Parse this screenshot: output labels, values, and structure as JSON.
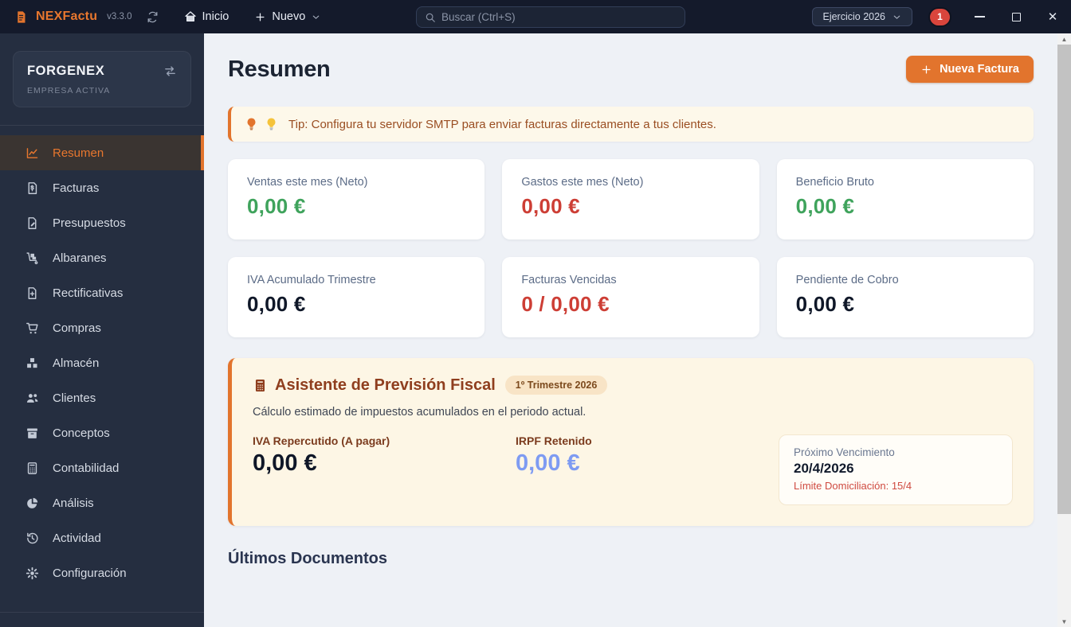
{
  "titlebar": {
    "app_name": "NEXFactu",
    "version": "v3.3.0",
    "home_label": "Inicio",
    "new_label": "Nuevo",
    "search_placeholder": "Buscar (Ctrl+S)",
    "exercise_selector": "Ejercicio 2026",
    "notification_count": "1"
  },
  "sidebar": {
    "company": {
      "name": "FORGENEX",
      "status": "EMPRESA ACTIVA"
    },
    "items": [
      {
        "key": "resumen",
        "label": "Resumen",
        "icon": "chart-line-icon",
        "active": true
      },
      {
        "key": "facturas",
        "label": "Facturas",
        "icon": "file-invoice-icon",
        "active": false
      },
      {
        "key": "presupuestos",
        "label": "Presupuestos",
        "icon": "file-signature-icon",
        "active": false
      },
      {
        "key": "albaranes",
        "label": "Albaranes",
        "icon": "dolly-icon",
        "active": false
      },
      {
        "key": "rectificativas",
        "label": "Rectificativas",
        "icon": "file-plus-icon",
        "active": false
      },
      {
        "key": "compras",
        "label": "Compras",
        "icon": "cart-icon",
        "active": false
      },
      {
        "key": "almacen",
        "label": "Almacén",
        "icon": "boxes-icon",
        "active": false
      },
      {
        "key": "clientes",
        "label": "Clientes",
        "icon": "users-icon",
        "active": false
      },
      {
        "key": "conceptos",
        "label": "Conceptos",
        "icon": "box-archive-icon",
        "active": false
      },
      {
        "key": "contabilidad",
        "label": "Contabilidad",
        "icon": "calculator-icon",
        "active": false
      },
      {
        "key": "analisis",
        "label": "Análisis",
        "icon": "pie-chart-icon",
        "active": false
      },
      {
        "key": "actividad",
        "label": "Actividad",
        "icon": "history-icon",
        "active": false
      },
      {
        "key": "configuracion",
        "label": "Configuración",
        "icon": "gear-icon",
        "active": false
      }
    ]
  },
  "main": {
    "page_title": "Resumen",
    "new_invoice_button": "Nueva Factura",
    "tip_text": "Tip: Configura tu servidor SMTP para enviar facturas directamente a tus clientes.",
    "stat_cards": [
      {
        "label": "Ventas este mes (Neto)",
        "value": "0,00 €",
        "color": "green"
      },
      {
        "label": "Gastos este mes (Neto)",
        "value": "0,00 €",
        "color": "red"
      },
      {
        "label": "Beneficio Bruto",
        "value": "0,00 €",
        "color": "green"
      },
      {
        "label": "IVA Acumulado Trimestre",
        "value": "0,00 €",
        "color": "dark"
      },
      {
        "label": "Facturas Vencidas",
        "value": "0 / 0,00 €",
        "color": "red"
      },
      {
        "label": "Pendiente de Cobro",
        "value": "0,00 €",
        "color": "dark"
      }
    ],
    "fiscal": {
      "title": "Asistente de Previsión Fiscal",
      "badge": "1º Trimestre 2026",
      "description": "Cálculo estimado de impuestos acumulados en el periodo actual.",
      "iva_label": "IVA Repercutido (A pagar)",
      "iva_value": "0,00 €",
      "irpf_label": "IRPF Retenido",
      "irpf_value": "0,00 €",
      "due": {
        "label": "Próximo Vencimiento",
        "date": "20/4/2026",
        "limit": "Límite Domiciliación: 15/4"
      }
    },
    "last_docs_title": "Últimos Documentos"
  },
  "colors": {
    "accent_orange": "#e2742d",
    "positive_green": "#3fa35c",
    "negative_red": "#cd3e35",
    "irpf_blue": "#7e9bf2",
    "badge_red": "#d9453c",
    "topbar_bg": "#141a2b",
    "sidebar_bg": "#252e40",
    "main_bg": "#eef1f6",
    "fiscal_bg": "#fdf6e5"
  }
}
